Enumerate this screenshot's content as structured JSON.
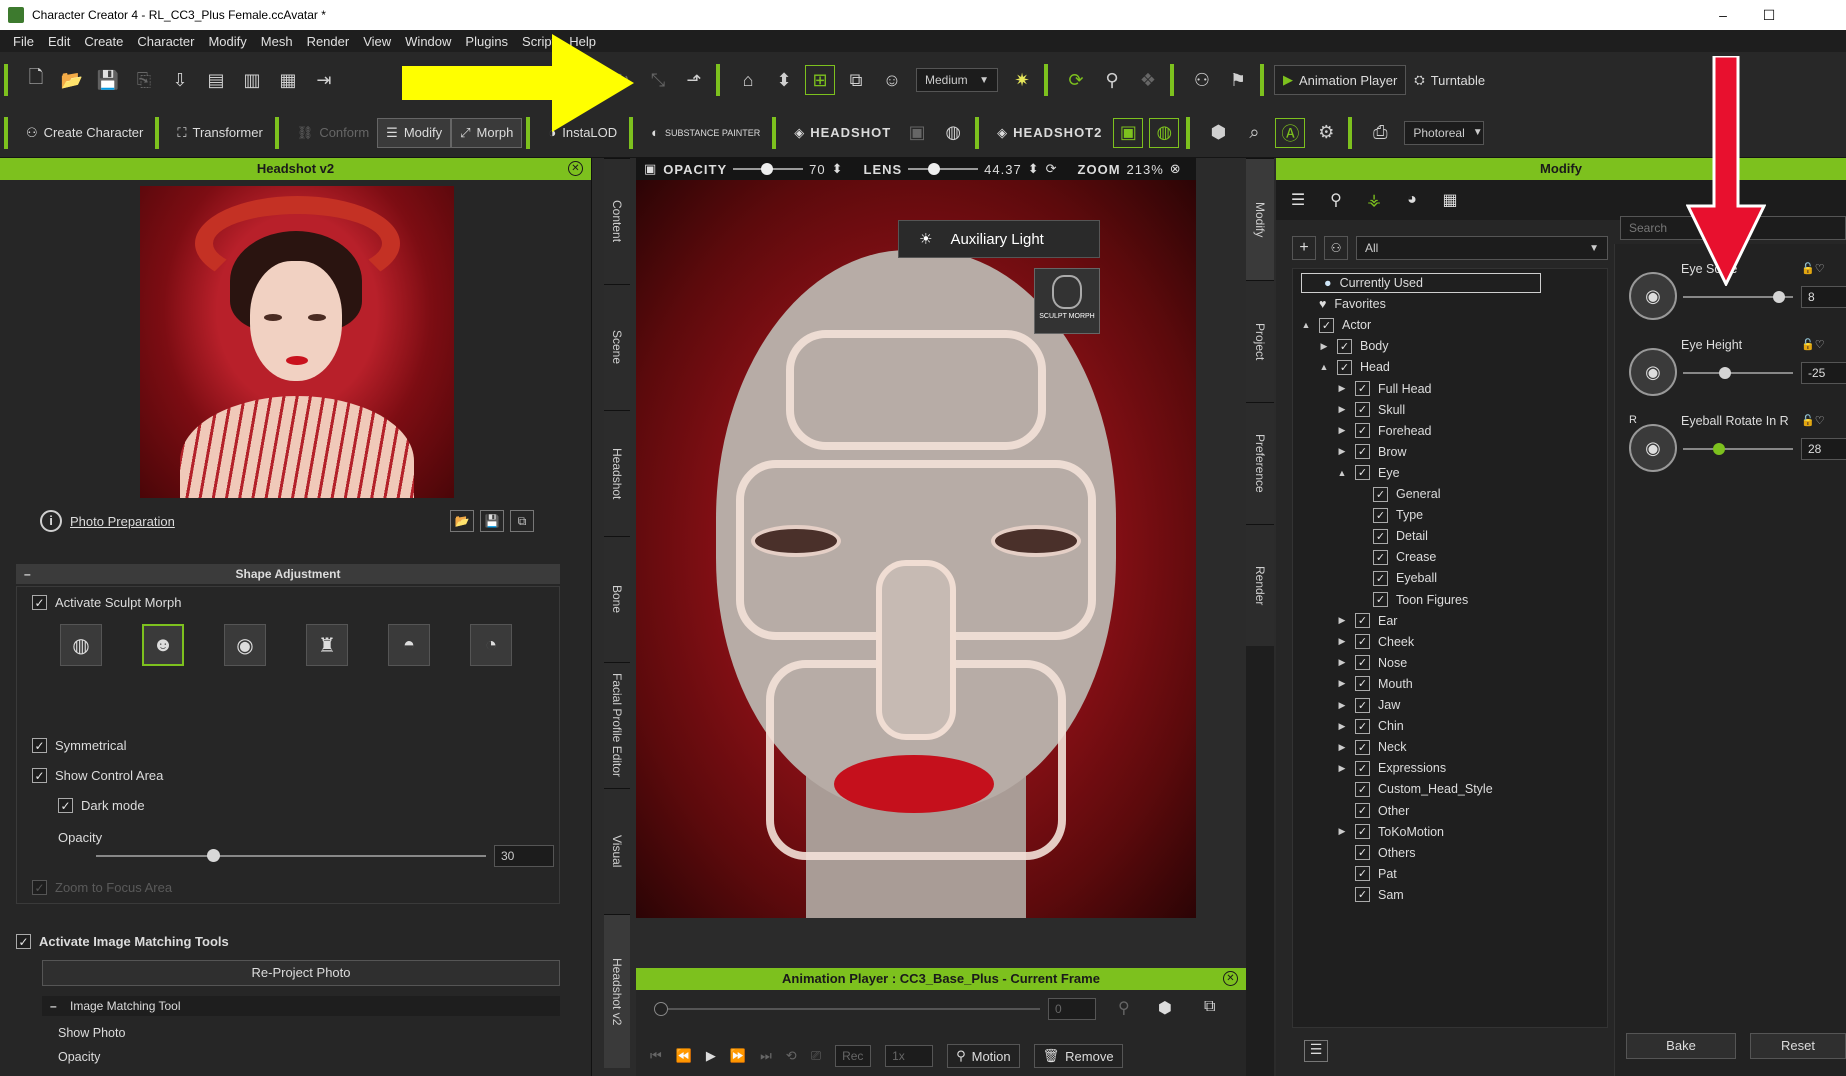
{
  "window": {
    "title": "Character Creator 4 - RL_CC3_Plus Female.ccAvatar *",
    "minimize": "–",
    "maximize": "☐"
  },
  "menu": [
    "File",
    "Edit",
    "Create",
    "Character",
    "Modify",
    "Mesh",
    "Render",
    "View",
    "Window",
    "Plugins",
    "Script",
    "Help"
  ],
  "toolbar1": {
    "quality_select": "Medium",
    "animation_player": "Animation Player",
    "turntable": "Turntable"
  },
  "toolbar2": {
    "create_character": "Create Character",
    "transformer": "Transformer",
    "conform": "Conform",
    "modify": "Modify",
    "morph": "Morph",
    "instalod": "InstaLOD",
    "substance_painter": "SUBSTANCE PAINTER",
    "headshot": "HEADSHOT",
    "headshot2": "HEADSHOT2",
    "render_select": "Photoreal"
  },
  "left_panel": {
    "title": "Headshot v2",
    "photo_preparation": "Photo Preparation",
    "shape_adjustment": "Shape Adjustment",
    "activate_sculpt_morph": "Activate Sculpt Morph",
    "symmetrical": "Symmetrical",
    "show_control_area": "Show Control Area",
    "dark_mode": "Dark mode",
    "opacity_label": "Opacity",
    "opacity_value": "30",
    "opacity_fraction": 0.3,
    "zoom_to_focus": "Zoom to Focus Area",
    "activate_image_matching": "Activate Image Matching Tools",
    "reproject_photo": "Re-Project Photo",
    "image_matching_tool": "Image Matching Tool",
    "show_photo": "Show Photo",
    "opacity2_label": "Opacity"
  },
  "left_tabs": [
    "Content",
    "Scene",
    "Headshot",
    "Bone",
    "Facial Profile Editor",
    "Visual",
    "Headshot v2"
  ],
  "viewport": {
    "opacity_label": "OPACITY",
    "opacity_value": "70",
    "lens_label": "LENS",
    "lens_value": "44.37",
    "zoom_label": "ZOOM",
    "zoom_value": "213%",
    "auxiliary_light": "Auxiliary Light",
    "sculpt_morph": "SCULPT MORPH"
  },
  "animation_player": {
    "title": "Animation Player : CC3_Base_Plus - Current Frame",
    "frame_value": "0",
    "rec_label": "Rec",
    "speed": "1x",
    "motion": "Motion",
    "remove": "Remove"
  },
  "right_tabs": [
    "Modify",
    "Project",
    "Preference",
    "Render"
  ],
  "right_panel": {
    "title": "Modify",
    "filter_select": "All",
    "search_placeholder": "Search",
    "tree": [
      {
        "label": "Currently Used",
        "level": 0,
        "type": "dot"
      },
      {
        "label": "Favorites",
        "level": 0,
        "type": "heart"
      },
      {
        "label": "Actor",
        "level": 0,
        "type": "check",
        "arrow": "▲"
      },
      {
        "label": "Body",
        "level": 1,
        "type": "check",
        "arrow": "▶"
      },
      {
        "label": "Head",
        "level": 1,
        "type": "check",
        "arrow": "▲"
      },
      {
        "label": "Full Head",
        "level": 2,
        "type": "check",
        "arrow": "▶"
      },
      {
        "label": "Skull",
        "level": 2,
        "type": "check",
        "arrow": "▶"
      },
      {
        "label": "Forehead",
        "level": 2,
        "type": "check",
        "arrow": "▶"
      },
      {
        "label": "Brow",
        "level": 2,
        "type": "check",
        "arrow": "▶"
      },
      {
        "label": "Eye",
        "level": 2,
        "type": "check",
        "arrow": "▲"
      },
      {
        "label": "General",
        "level": 3,
        "type": "check"
      },
      {
        "label": "Type",
        "level": 3,
        "type": "check"
      },
      {
        "label": "Detail",
        "level": 3,
        "type": "check"
      },
      {
        "label": "Crease",
        "level": 3,
        "type": "check"
      },
      {
        "label": "Eyeball",
        "level": 3,
        "type": "check"
      },
      {
        "label": "Toon Figures",
        "level": 3,
        "type": "check"
      },
      {
        "label": "Ear",
        "level": 2,
        "type": "check",
        "arrow": "▶"
      },
      {
        "label": "Cheek",
        "level": 2,
        "type": "check",
        "arrow": "▶"
      },
      {
        "label": "Nose",
        "level": 2,
        "type": "check",
        "arrow": "▶"
      },
      {
        "label": "Mouth",
        "level": 2,
        "type": "check",
        "arrow": "▶"
      },
      {
        "label": "Jaw",
        "level": 2,
        "type": "check",
        "arrow": "▶"
      },
      {
        "label": "Chin",
        "level": 2,
        "type": "check",
        "arrow": "▶"
      },
      {
        "label": "Neck",
        "level": 2,
        "type": "check",
        "arrow": "▶"
      },
      {
        "label": "Expressions",
        "level": 2,
        "type": "check",
        "arrow": "▶"
      },
      {
        "label": "Custom_Head_Style",
        "level": 2,
        "type": "check"
      },
      {
        "label": "Other",
        "level": 2,
        "type": "check"
      },
      {
        "label": "ToKoMotion",
        "level": 2,
        "type": "check",
        "arrow": "▶"
      },
      {
        "label": "Others",
        "level": 2,
        "type": "check"
      },
      {
        "label": "Pat",
        "level": 2,
        "type": "check"
      },
      {
        "label": "Sam",
        "level": 2,
        "type": "check"
      }
    ],
    "sliders": [
      {
        "label": "Eye Scale",
        "value": "8",
        "fraction": 0.87,
        "active": false
      },
      {
        "label": "Eye Height",
        "value": "-25",
        "fraction": 0.38,
        "active": false
      },
      {
        "label": "Eyeball Rotate In R",
        "value": "28",
        "fraction": 0.33,
        "active": true,
        "prefix": "R"
      }
    ],
    "bake": "Bake",
    "reset": "Reset"
  },
  "colors": {
    "accent": "#7dc11e",
    "yellow_arrow": "#ffff00",
    "red_arrow": "#e8102e"
  }
}
